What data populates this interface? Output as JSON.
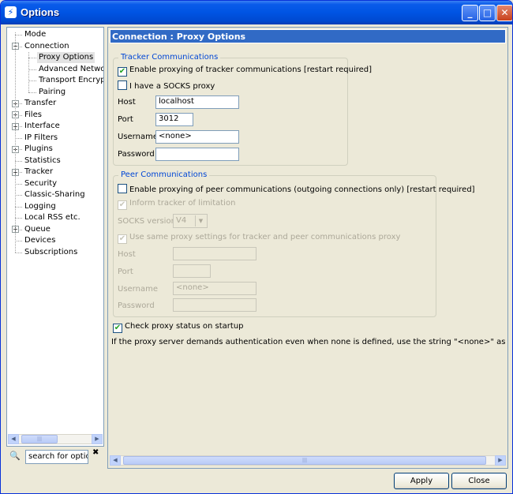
{
  "window": {
    "title": "Options"
  },
  "tree": [
    {
      "label": "Mode",
      "level": 0,
      "expander": ""
    },
    {
      "label": "Connection",
      "level": 0,
      "expander": "−"
    },
    {
      "label": "Proxy Options",
      "level": 1,
      "expander": "",
      "selected": true
    },
    {
      "label": "Advanced Network",
      "level": 1,
      "expander": ""
    },
    {
      "label": "Transport Encryption",
      "level": 1,
      "expander": ""
    },
    {
      "label": "Pairing",
      "level": 1,
      "expander": ""
    },
    {
      "label": "Transfer",
      "level": 0,
      "expander": "+"
    },
    {
      "label": "Files",
      "level": 0,
      "expander": "+"
    },
    {
      "label": "Interface",
      "level": 0,
      "expander": "+"
    },
    {
      "label": "IP Filters",
      "level": 0,
      "expander": ""
    },
    {
      "label": "Plugins",
      "level": 0,
      "expander": "+"
    },
    {
      "label": "Statistics",
      "level": 0,
      "expander": ""
    },
    {
      "label": "Tracker",
      "level": 0,
      "expander": "+"
    },
    {
      "label": "Security",
      "level": 0,
      "expander": ""
    },
    {
      "label": "Classic-Sharing",
      "level": 0,
      "expander": ""
    },
    {
      "label": "Logging",
      "level": 0,
      "expander": ""
    },
    {
      "label": "Local RSS etc.",
      "level": 0,
      "expander": ""
    },
    {
      "label": "Queue",
      "level": 0,
      "expander": "+"
    },
    {
      "label": "Devices",
      "level": 0,
      "expander": ""
    },
    {
      "label": "Subscriptions",
      "level": 0,
      "expander": ""
    }
  ],
  "search": {
    "value": "search for option"
  },
  "header": {
    "title": "Connection : Proxy Options"
  },
  "tracker": {
    "legend": "Tracker Communications",
    "enable_label": "Enable proxying of tracker communications [restart required]",
    "enable_checked": true,
    "socks_label": "I have a SOCKS proxy",
    "socks_checked": false,
    "host_label": "Host",
    "host_value": "localhost",
    "port_label": "Port",
    "port_value": "3012",
    "username_label": "Username",
    "username_value": "<none>",
    "password_label": "Password",
    "password_value": ""
  },
  "peer": {
    "legend": "Peer Communications",
    "enable_label": "Enable proxying of peer communications (outgoing connections only) [restart required]",
    "enable_checked": false,
    "inform_label": "Inform tracker of limitation",
    "inform_checked": true,
    "socks_version_label": "SOCKS version",
    "socks_version_value": "V4",
    "same_label": "Use same proxy settings for tracker and peer communications proxy",
    "same_checked": true,
    "host_label": "Host",
    "host_value": "",
    "port_label": "Port",
    "port_value": "",
    "username_label": "Username",
    "username_value": "<none>",
    "password_label": "Password",
    "password_value": ""
  },
  "check_status": {
    "label": "Check proxy status on startup",
    "checked": true
  },
  "info_text": "If the proxy server demands authentication even when none is defined, use the string \"<none>\" as the username(",
  "buttons": {
    "apply": "Apply",
    "close": "Close"
  },
  "icons": {
    "check": "✔",
    "minimize": "_",
    "maximize": "□",
    "close": "✕",
    "left": "◀",
    "right": "▶",
    "down": "▼",
    "search": "🔍",
    "clear": "✖"
  }
}
